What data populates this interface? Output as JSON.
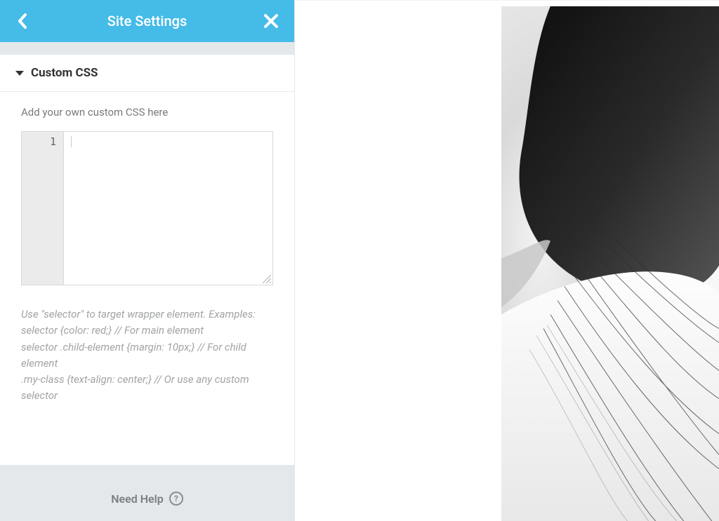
{
  "header": {
    "title": "Site Settings"
  },
  "section": {
    "title": "Custom CSS"
  },
  "intro": "Add your own custom CSS here",
  "editor": {
    "lineno": "1",
    "value": ""
  },
  "hint": "Use \"selector\" to target wrapper element. Examples:\nselector {color: red;} // For main element\nselector .child-element {margin: 10px;} // For child element\n.my-class {text-align: center;} // Or use any custom selector",
  "footer": {
    "help": "Need Help"
  }
}
